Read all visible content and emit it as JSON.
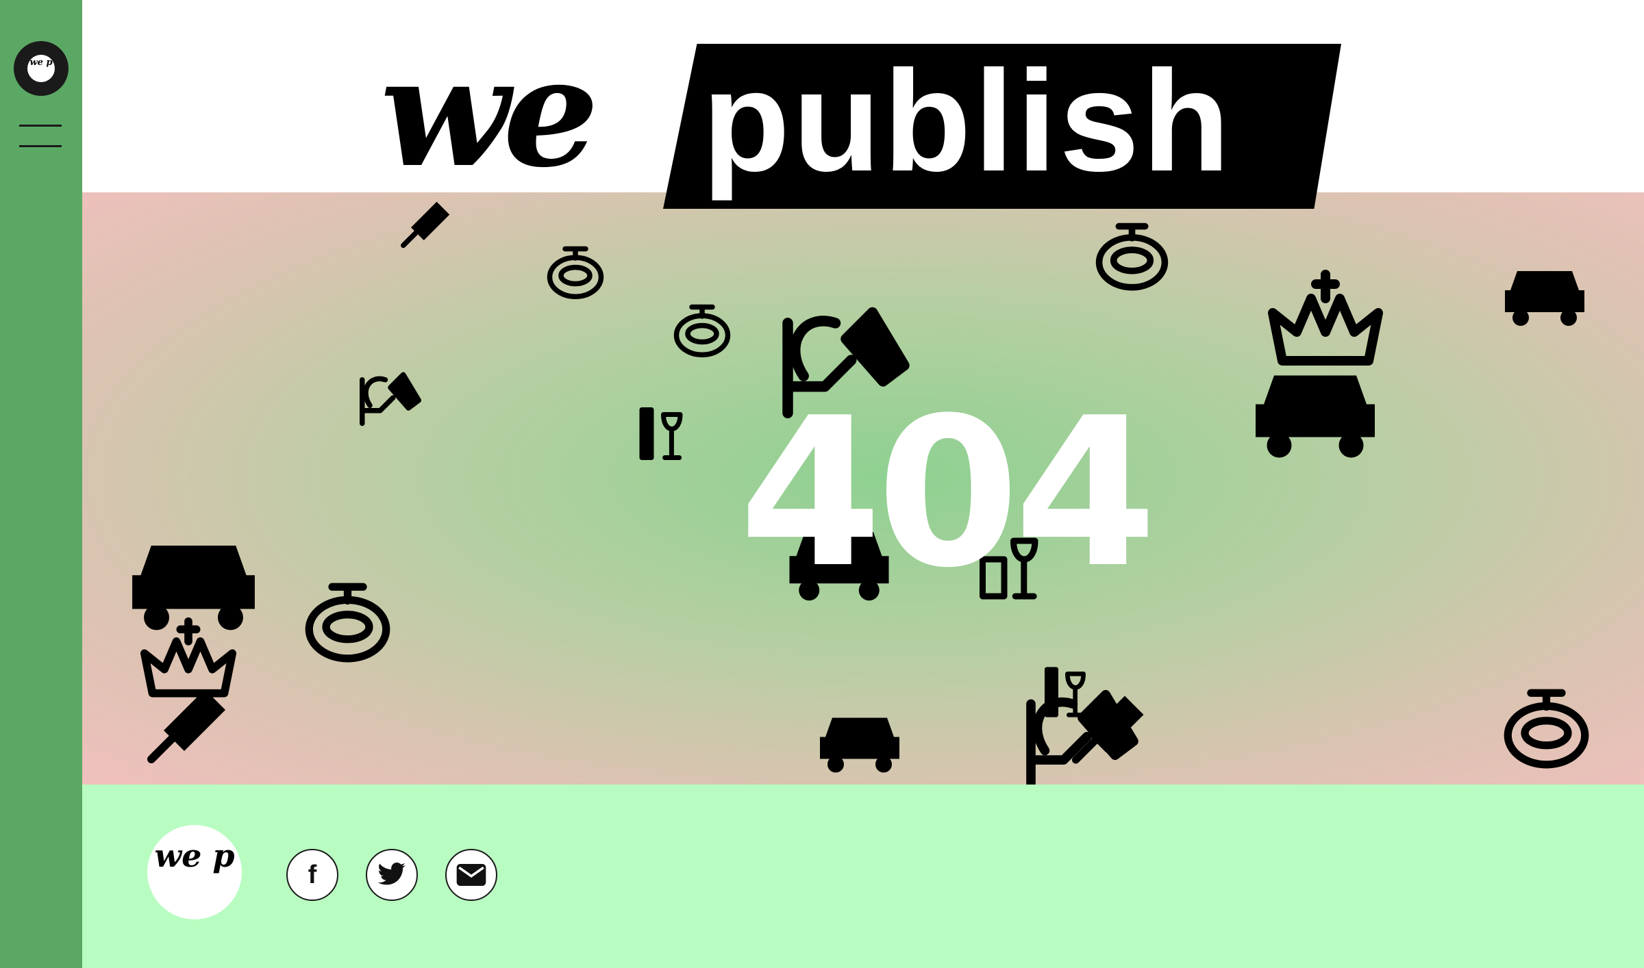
{
  "sidebar": {
    "logo_text": "we p",
    "menu_icon": "hamburger-menu-icon"
  },
  "header": {
    "brand_prefix": "we",
    "brand_suffix": "publish"
  },
  "hero": {
    "error_code": "404",
    "doodle_icons": [
      "car-icon",
      "stadium-icon",
      "crown-icon",
      "popsicle-icon",
      "camera-icon",
      "wine-icon"
    ]
  },
  "footer": {
    "logo_text": "we p",
    "social": [
      {
        "name": "facebook",
        "label": "f"
      },
      {
        "name": "twitter",
        "icon": "twitter-bird-icon"
      },
      {
        "name": "email",
        "icon": "envelope-icon"
      }
    ]
  },
  "colors": {
    "sidebar": "#5ba865",
    "footer": "#b8fcc1",
    "hero_center": "#8ed191",
    "hero_edge": "#f0c0bd",
    "brand_black": "#000000"
  }
}
